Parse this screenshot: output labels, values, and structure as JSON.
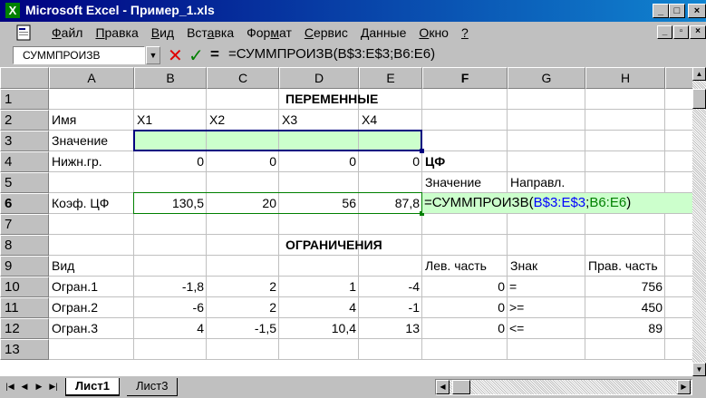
{
  "window": {
    "title": "Microsoft Excel - Пример_1.xls",
    "minimize": "_",
    "maximize": "□",
    "close": "×"
  },
  "menu": {
    "items": [
      {
        "hotkey": "Ф",
        "rest": "айл"
      },
      {
        "hotkey": "П",
        "rest": "равка"
      },
      {
        "hotkey": "В",
        "rest": "ид"
      },
      {
        "pre": "Вст",
        "hotkey": "а",
        "rest": "вка"
      },
      {
        "pre": "Фор",
        "hotkey": "м",
        "rest": "ат"
      },
      {
        "hotkey": "С",
        "rest": "ервис"
      },
      {
        "hotkey": "Д",
        "rest": "анные"
      },
      {
        "hotkey": "О",
        "rest": "кно"
      },
      {
        "hotkey": "?",
        "rest": ""
      }
    ]
  },
  "formula_bar": {
    "name_box": "СУММПРОИЗВ",
    "equals": "=",
    "content": "=СУММПРОИЗВ(B$3:E$3;B6:E6)"
  },
  "columns": [
    "A",
    "B",
    "C",
    "D",
    "E",
    "F",
    "G",
    "H"
  ],
  "rows": [
    "1",
    "2",
    "3",
    "4",
    "5",
    "6",
    "7",
    "8",
    "9",
    "10",
    "11",
    "12",
    "13"
  ],
  "active_row": "6",
  "active_column": "F",
  "cells": {
    "D1": "ПЕРЕМЕННЫЕ",
    "A2": "Имя",
    "B2": "X1",
    "C2": "X2",
    "D2": "X3",
    "E2": "X4",
    "A3": "Значение",
    "A4": "Нижн.гр.",
    "B4": "0",
    "C4": "0",
    "D4": "0",
    "E4": "0",
    "F4": "ЦФ",
    "F5": "Значение",
    "G5": "Направл.",
    "A6": "Коэф. ЦФ",
    "B6": "130,5",
    "C6": "20",
    "D6": "56",
    "E6": "87,8",
    "D8": "ОГРАНИЧЕНИЯ",
    "A9": "Вид",
    "F9": "Лев. часть",
    "G9": "Знак",
    "H9": "Прав. часть",
    "A10": "Огран.1",
    "B10": "-1,8",
    "C10": "2",
    "D10": "1",
    "E10": "-4",
    "F10": "0",
    "G10": "=",
    "H10": "756",
    "A11": "Огран.2",
    "B11": "-6",
    "C11": "2",
    "D11": "4",
    "E11": "-1",
    "F11": "0",
    "G11": ">=",
    "H11": "450",
    "A12": "Огран.3",
    "B12": "4",
    "C12": "-1,5",
    "D12": "10,4",
    "E12": "13",
    "F12": "0",
    "G12": "<=",
    "H12": "89"
  },
  "editing_cell": {
    "prefix": "=СУММПРОИЗВ(",
    "ref1": "B$3:E$3",
    "sep": ";",
    "ref2": "B6:E6",
    "suffix": ")"
  },
  "sheets": {
    "active": "Лист1",
    "other": "Лист3"
  },
  "colors": {
    "highlight": "#ccffcc",
    "title_bar": "#000080",
    "ref_blue": "#0000ff",
    "ref_green": "#008000"
  }
}
